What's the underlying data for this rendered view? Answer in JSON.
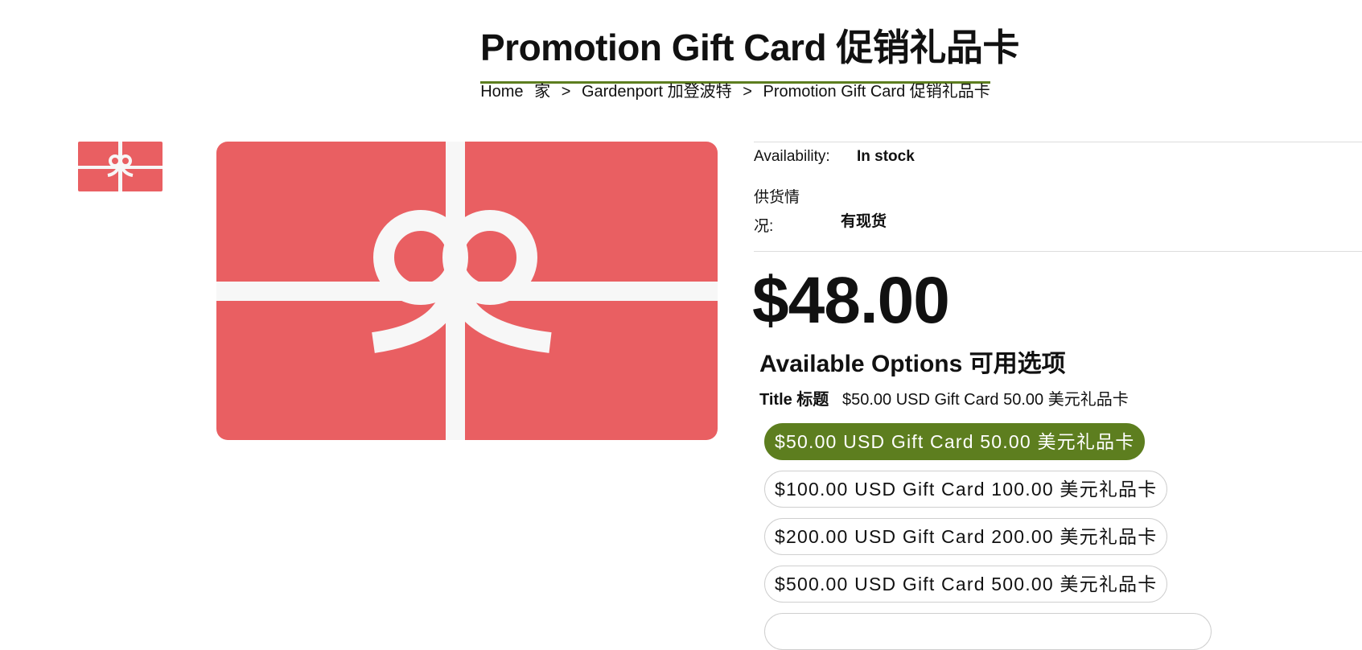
{
  "page": {
    "title": "Promotion Gift Card 促销礼品卡"
  },
  "breadcrumb": {
    "home": "Home",
    "home_cn": "家",
    "separator": ">",
    "collection": "Gardenport 加登波特",
    "current": "Promotion Gift Card 促销礼品卡"
  },
  "product": {
    "image_name": "gift-card-image",
    "thumbnail_name": "gift-card-thumbnail",
    "availability_label": "Availability:",
    "availability_value": "In stock",
    "availability_label_cn": "供货情况:",
    "availability_value_cn": "有现货",
    "price": "$48.00"
  },
  "options": {
    "heading": "Available Options 可用选项",
    "title_label": "Title 标题",
    "title_value": "$50.00 USD Gift Card 50.00 美元礼品卡",
    "choices": [
      {
        "label": "$50.00 USD Gift Card 50.00 美元礼品卡",
        "selected": true
      },
      {
        "label": "$100.00 USD Gift Card 100.00 美元礼品卡",
        "selected": false
      },
      {
        "label": "$200.00 USD Gift Card 200.00 美元礼品卡",
        "selected": false
      },
      {
        "label": "$500.00 USD Gift Card 500.00 美元礼品卡",
        "selected": false
      }
    ]
  },
  "colors": {
    "accent": "#5d7e1f",
    "card_red": "#e95f62",
    "ribbon": "#f7f7f7"
  }
}
